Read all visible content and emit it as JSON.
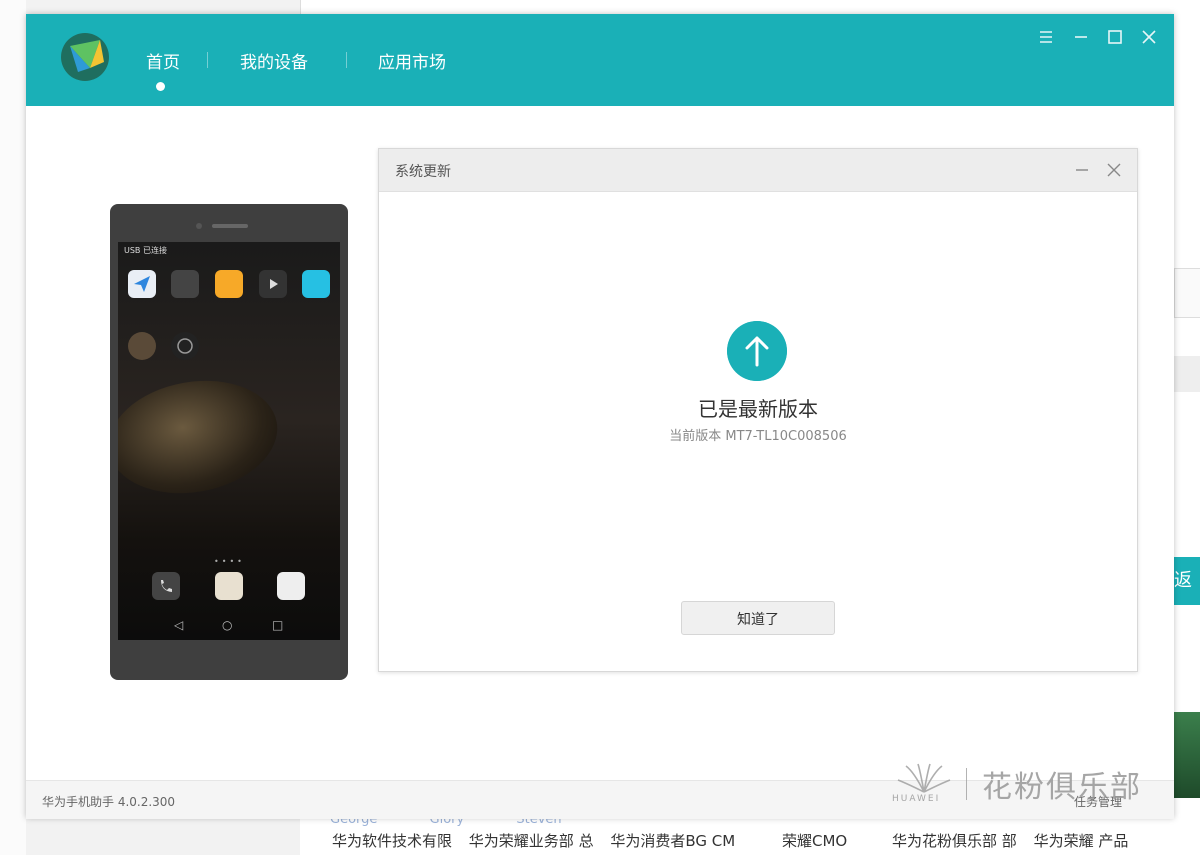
{
  "app": {
    "nav_tabs": [
      {
        "label": "首页",
        "active": true
      },
      {
        "label": "我的设备",
        "active": false
      },
      {
        "label": "应用市场",
        "active": false
      }
    ],
    "window_controls": [
      "menu-icon",
      "minimize-icon",
      "maximize-icon",
      "close-icon"
    ],
    "footer_version": "华为手机助手 4.0.2.300",
    "footer_right": "任务管理",
    "brand_color": "#1ab0b7"
  },
  "phone": {
    "status_text": "USB 已连接"
  },
  "dialog": {
    "title": "系统更新",
    "status": "已是最新版本",
    "version": "当前版本 MT7-TL10C008506",
    "ok_label": "知道了"
  },
  "background_page": {
    "bottom_labels": [
      "华为软件技术有限",
      "华为荣耀业务部 总",
      "华为消费者BG CM",
      "荣耀CMO",
      "华为花粉俱乐部 部",
      "华为荣耀 产品"
    ],
    "faded_names": [
      "George",
      "Glory",
      "Steven"
    ],
    "right_edge_text": "返回"
  },
  "watermark": {
    "text": "花粉俱乐部",
    "brand": "HUAWEI"
  }
}
